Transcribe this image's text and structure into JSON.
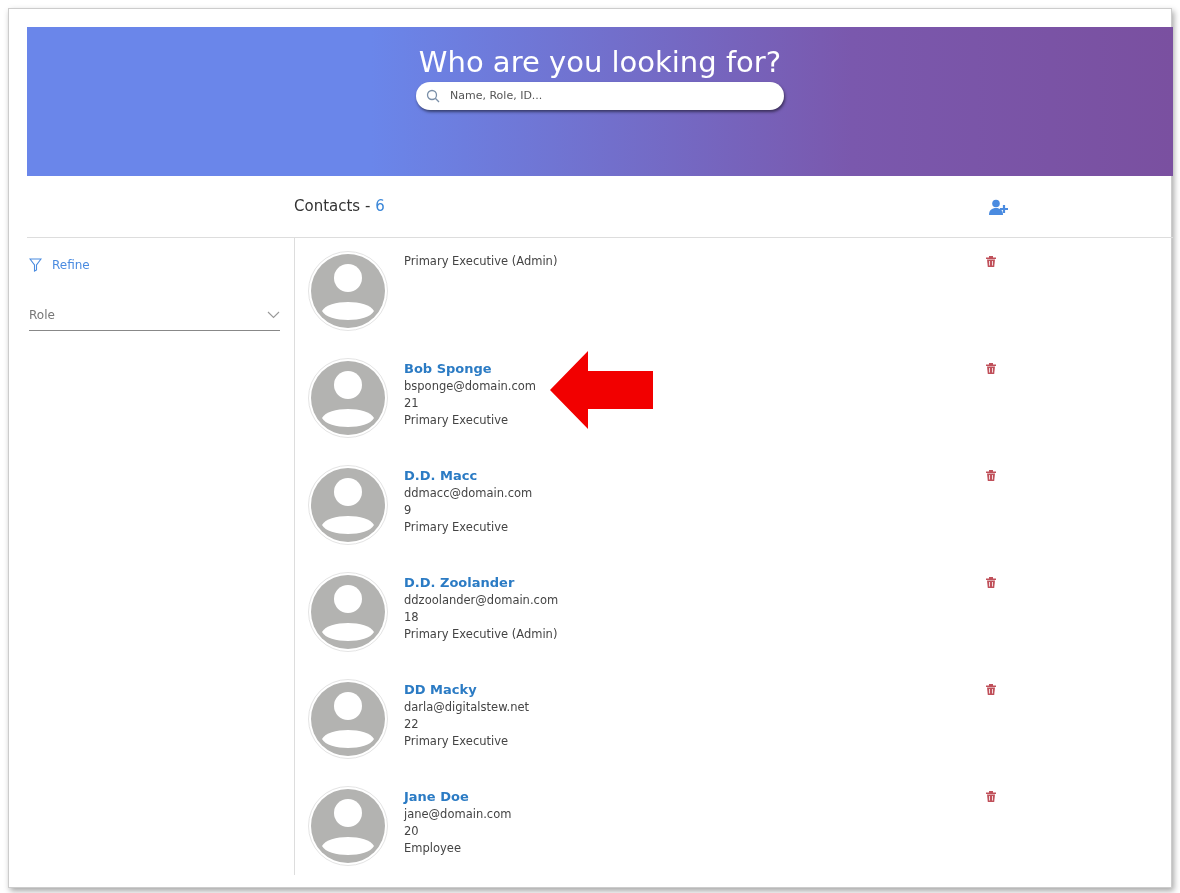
{
  "banner": {
    "title": "Who are you looking for?",
    "search": {
      "placeholder": "Name, Role, ID..."
    }
  },
  "header": {
    "label": "Contacts - ",
    "count": "6"
  },
  "sidebar": {
    "refine": "Refine",
    "role_select": {
      "placeholder": "Role"
    }
  },
  "contacts": [
    {
      "role": "Primary Executive (Admin)",
      "pointed_at": false
    },
    {
      "name": "Bob Sponge",
      "email": "bsponge@domain.com",
      "number": "21",
      "role": "Primary Executive",
      "pointed_at": true
    },
    {
      "name": "D.D. Macc",
      "email": "ddmacc@domain.com",
      "number": "9",
      "role": "Primary Executive",
      "pointed_at": false
    },
    {
      "name": "D.D. Zoolander",
      "email": "ddzoolander@domain.com",
      "number": "18",
      "role": "Primary Executive (Admin)",
      "pointed_at": false
    },
    {
      "name": "DD Macky",
      "email": "darla@digitalstew.net",
      "number": "22",
      "role": "Primary Executive",
      "pointed_at": false
    },
    {
      "name": "Jane Doe",
      "email": "jane@domain.com",
      "number": "20",
      "role": "Employee",
      "pointed_at": false
    }
  ]
}
